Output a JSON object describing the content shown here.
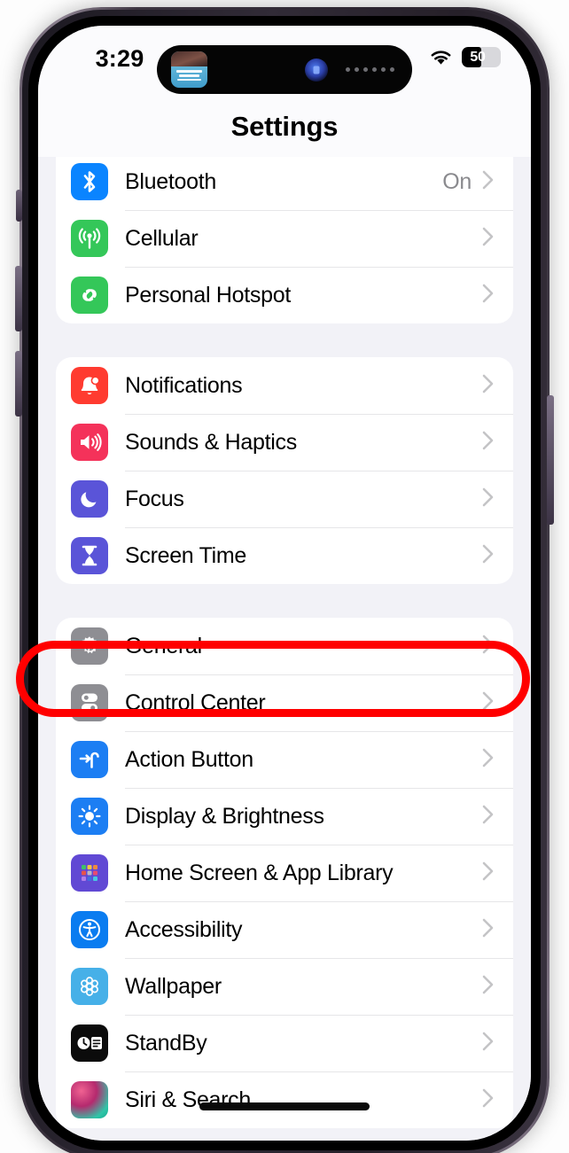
{
  "status_bar": {
    "time": "3:29",
    "wifi_icon": "wifi-icon",
    "battery_level": "50",
    "battery_percent": 50,
    "dynamic_island": {
      "live_activity_icon": "album-art-icon",
      "siri_orb_icon": "siri-orb-icon",
      "audio_waveform_icon": "audio-dots-icon"
    }
  },
  "nav": {
    "title": "Settings"
  },
  "groups": [
    {
      "name": "connectivity",
      "rows": [
        {
          "label": "Bluetooth",
          "value": "On",
          "icon": "bluetooth-icon",
          "icon_color": "#0a84ff"
        },
        {
          "label": "Cellular",
          "value": "",
          "icon": "cellular-icon",
          "icon_color": "#34c759"
        },
        {
          "label": "Personal Hotspot",
          "value": "",
          "icon": "hotspot-icon",
          "icon_color": "#34c759"
        }
      ]
    },
    {
      "name": "alerts",
      "rows": [
        {
          "label": "Notifications",
          "value": "",
          "icon": "notifications-bell-icon",
          "icon_color": "#ff3b30"
        },
        {
          "label": "Sounds & Haptics",
          "value": "",
          "icon": "sounds-speaker-icon",
          "icon_color": "#f4325a"
        },
        {
          "label": "Focus",
          "value": "",
          "icon": "focus-moon-icon",
          "icon_color": "#5a54d8"
        },
        {
          "label": "Screen Time",
          "value": "",
          "icon": "screen-time-hourglass-icon",
          "icon_color": "#5a54d8"
        }
      ]
    },
    {
      "name": "system",
      "rows": [
        {
          "label": "General",
          "value": "",
          "icon": "general-gear-icon",
          "icon_color": "#8e8e93"
        },
        {
          "label": "Control Center",
          "value": "",
          "icon": "control-center-icon",
          "icon_color": "#8e8e93"
        },
        {
          "label": "Action Button",
          "value": "",
          "icon": "action-button-icon",
          "icon_color": "#1c7ef3"
        },
        {
          "label": "Display & Brightness",
          "value": "",
          "icon": "display-brightness-icon",
          "icon_color": "#1c7ef3"
        },
        {
          "label": "Home Screen & App Library",
          "value": "",
          "icon": "home-screen-grid-icon",
          "icon_color": "#6149d4"
        },
        {
          "label": "Accessibility",
          "value": "",
          "icon": "accessibility-icon",
          "icon_color": "#0a7cf0"
        },
        {
          "label": "Wallpaper",
          "value": "",
          "icon": "wallpaper-flower-icon",
          "icon_color": "#46b0e8"
        },
        {
          "label": "StandBy",
          "value": "",
          "icon": "standby-icon",
          "icon_color": "#0b0b0b"
        },
        {
          "label": "Siri & Search",
          "value": "",
          "icon": "siri-icon",
          "icon_color": "#c0397a"
        }
      ]
    }
  ],
  "annotation": {
    "type": "highlight-oval",
    "target_label": "General",
    "color": "#ff0000"
  },
  "chevron_icon": "chevron-right-icon",
  "home_indicator_icon": "home-indicator"
}
